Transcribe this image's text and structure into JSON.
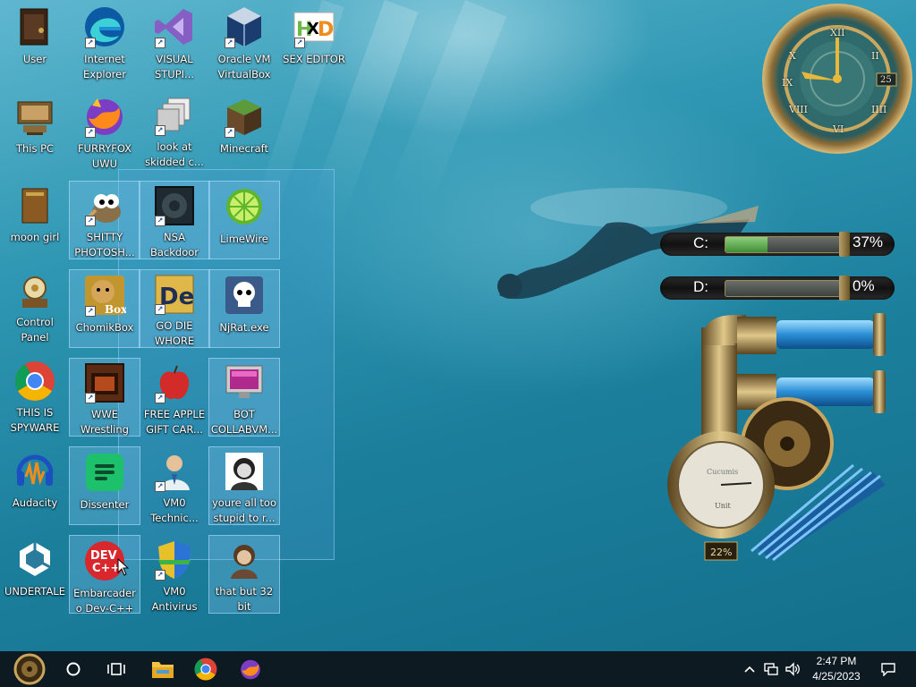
{
  "desktop": {
    "column1": [
      {
        "label": "User",
        "icon": "user-folder-icon"
      },
      {
        "label": "This PC",
        "icon": "computer-icon"
      },
      {
        "label": "moon girl",
        "icon": "folder-icon"
      },
      {
        "label": "Control Panel",
        "icon": "control-panel-icon"
      },
      {
        "label": "THIS IS SPYWARE",
        "icon": "chrome-icon"
      },
      {
        "label": "Audacity",
        "icon": "audacity-icon"
      },
      {
        "label": "UNDERTALE",
        "icon": "unity-icon"
      }
    ],
    "column2": [
      {
        "label": "Internet Explorer",
        "icon": "edge-icon"
      },
      {
        "label": "FURRYFOX UWU",
        "icon": "firefox-icon"
      },
      {
        "label": "SHITTY PHOTOSH...",
        "icon": "gimp-icon"
      },
      {
        "label": "ChomikBox",
        "icon": "chomikbox-icon"
      },
      {
        "label": "WWE Wrestling",
        "icon": "wwe-icon"
      },
      {
        "label": "Dissenter",
        "icon": "dissenter-icon"
      },
      {
        "label": "Embarcadero Dev-C++",
        "icon": "devcpp-icon"
      }
    ],
    "column3": [
      {
        "label": "VISUAL STUPI...",
        "icon": "visual-studio-icon"
      },
      {
        "label": "look at skidded c...",
        "icon": "copies-icon"
      },
      {
        "label": "NSA Backdoor",
        "icon": "nsa-icon"
      },
      {
        "label": "GO DIE WHORE",
        "icon": "de-icon"
      },
      {
        "label": "FREE APPLE GIFT CAR...",
        "icon": "apple-icon"
      },
      {
        "label": "VM0 Technic...",
        "icon": "technician-icon"
      },
      {
        "label": "VM0 Antivirus",
        "icon": "shield-icon"
      }
    ],
    "column4": [
      {
        "label": "Oracle VM VirtualBox",
        "icon": "virtualbox-icon"
      },
      {
        "label": "Minecraft",
        "icon": "minecraft-icon"
      },
      {
        "label": "LimeWire",
        "icon": "limewire-icon"
      },
      {
        "label": "NjRat.exe",
        "icon": "skull-icon"
      },
      {
        "label": "BOT COLLABVM...",
        "icon": "monitor-icon"
      },
      {
        "label": "youre all too stupid to r...",
        "icon": "portrait-icon"
      },
      {
        "label": "that but 32 bit",
        "icon": "portrait-icon"
      }
    ],
    "column5": [
      {
        "label": "SEX EDITOR",
        "icon": "hxd-icon"
      }
    ]
  },
  "gadgets": {
    "clock": {
      "numerals": [
        "XII",
        "I",
        "II",
        "III",
        "IIII",
        "V",
        "VI",
        "VII",
        "VIII",
        "IX",
        "X",
        "XI"
      ],
      "date_badge": "25"
    },
    "drives": [
      {
        "letter": "C:",
        "percent": "37%",
        "fill": 0.37
      },
      {
        "letter": "D:",
        "percent": "0%",
        "fill": 0.0
      }
    ],
    "gauge": {
      "top_label": "Cucumis",
      "bottom_label": "Unit",
      "readout": "22%"
    }
  },
  "taskbar": {
    "time": "2:47 PM",
    "date": "4/25/2023",
    "pinned": [
      "start-orb-icon",
      "search-circle-icon",
      "task-view-icon",
      "file-explorer-icon",
      "chrome-icon",
      "firefox-icon"
    ],
    "tray": [
      "chevron-up-icon",
      "network-icon",
      "volume-icon",
      "notification-icon"
    ]
  },
  "colors": {
    "taskbar_bg": "#0d1a22",
    "selection": "#78bee6",
    "water": "#1b7f9c"
  }
}
